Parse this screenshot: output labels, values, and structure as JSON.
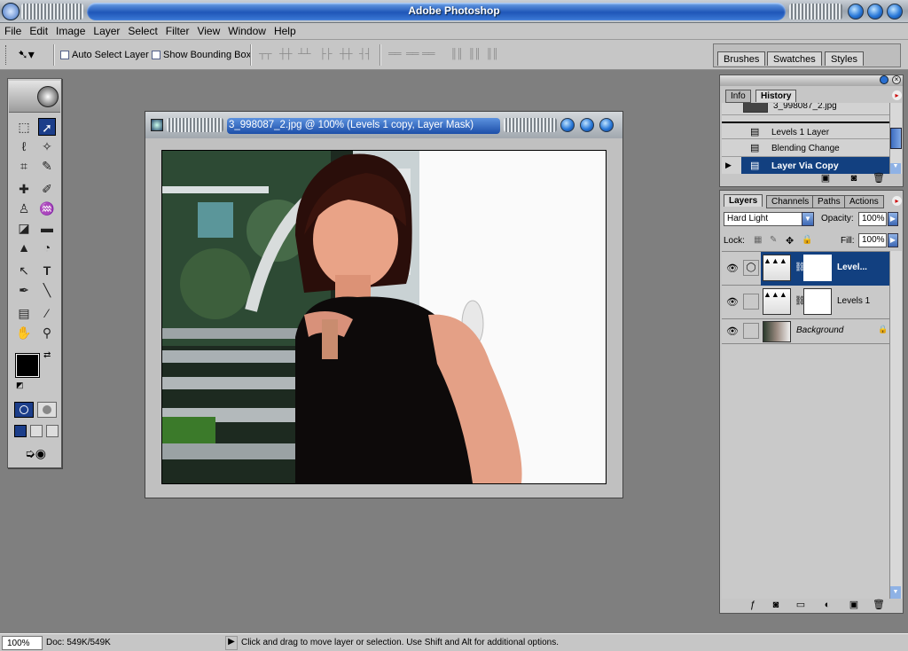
{
  "app": {
    "title": "Adobe Photoshop"
  },
  "menu": [
    "File",
    "Edit",
    "Image",
    "Layer",
    "Select",
    "Filter",
    "View",
    "Window",
    "Help"
  ],
  "options": {
    "auto_select_layer": "Auto Select Layer",
    "show_bounding_box": "Show Bounding Box"
  },
  "palette_well": {
    "tabs": [
      "Brushes",
      "Swatches",
      "Styles"
    ]
  },
  "document": {
    "title": "3_998087_2.jpg @ 100% (Levels 1 copy, Layer Mask)"
  },
  "history": {
    "tabs": [
      "Info",
      "History"
    ],
    "active_tab": "History",
    "items": [
      {
        "label": "3_998087_2.jpg",
        "selected": false
      },
      {
        "label": "Levels 1 Layer",
        "selected": false
      },
      {
        "label": "Blending Change",
        "selected": false
      },
      {
        "label": "Layer Via Copy",
        "selected": true
      }
    ]
  },
  "layers": {
    "tabs": [
      "Layers",
      "Channels",
      "Paths",
      "Actions"
    ],
    "active_tab": "Layers",
    "blend_mode": "Hard Light",
    "opacity_label": "Opacity:",
    "opacity": "100%",
    "lock_label": "Lock:",
    "fill_label": "Fill:",
    "fill": "100%",
    "items": [
      {
        "name": "Level...",
        "selected": true,
        "italic": false
      },
      {
        "name": "Levels 1",
        "selected": false,
        "italic": false
      },
      {
        "name": "Background",
        "selected": false,
        "italic": true
      }
    ]
  },
  "status": {
    "zoom": "100%",
    "doc": "Doc: 549K/549K",
    "hint": "Click and drag to move layer or selection.  Use Shift and Alt for additional options."
  },
  "colors": {
    "accent": "#124080",
    "workspace": "#7f7f7f"
  }
}
